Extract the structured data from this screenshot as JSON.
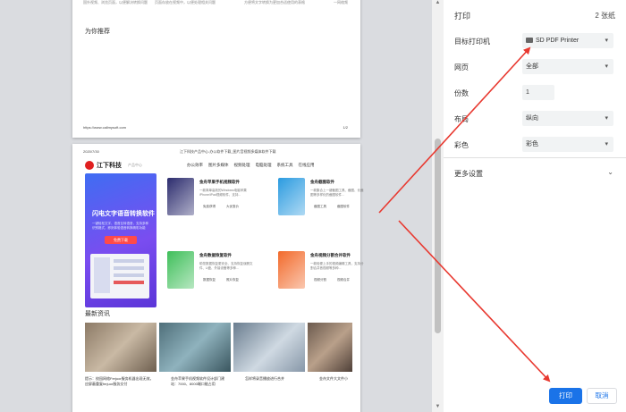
{
  "preview": {
    "page1": {
      "top_texts": [
        "国外视频、浏览页面，以便解决转换问题",
        "页面存放在视频中，以便处理相关问题",
        "方便将文字转换为更加合适使用的表格",
        "一网络频"
      ],
      "recommend": "为你推荐",
      "url": "https://www.callmysoft.com",
      "page_num": "1/2"
    },
    "page2": {
      "date": "2020/7/30",
      "header_title": "江下科技产品中心-办公软件下载_图片音视频多媒体软件下载",
      "logo_name": "江下科技",
      "logo_sub": "产品中心",
      "nav": [
        "办公效率",
        "图片多媒体",
        "视频处理",
        "电脑处理",
        "系统工具",
        "在线应用"
      ],
      "banner": {
        "title": "闪电文字语音转换软件",
        "desc": "一键轻松文字、语音互转语音，支持多种识别格式，即刻体验语音转换精彩功能",
        "button": "免费下载"
      },
      "products": [
        {
          "name": "金舟苹果手机视频软件",
          "desc": "一款简单高效的Windows电脑苹果iPhone/iPad视频软件，支持...",
          "links": [
            "免费获得",
            "大优惠价"
          ],
          "color": "#2c2c6e"
        },
        {
          "name": "金舟截图软件",
          "desc": "一款集合上一键截图工具、截图、长截图等多样化的截图软件...",
          "links": [
            "截图工具",
            "截图软件"
          ],
          "color": "#2b9be0"
        },
        {
          "name": "金舟数据恢复软件",
          "desc": "助您数据恢复更安全、支持恢复误删文件、U盘、外接设备等多种...",
          "links": [
            "数据恢复",
            "照片恢复"
          ],
          "color": "#3fbf5a"
        },
        {
          "name": "金舟视频分割合并软件",
          "desc": "一款轻便上手的视频编辑工具，支持分割合并音视频等多种...",
          "links": [
            "视频分割",
            "视频合并"
          ],
          "color": "#f26a2b"
        }
      ],
      "news_heading": "最新资讯",
      "news": [
        "提示：校园网络Ferjuor服务机器出现无效，应屏蔽重复ferjuor服务交付",
        "金舟苹果手机视频软件设计部门建站：7000、8000端口能占用",
        "怎样将录音播放进行合并",
        "金舟文件大文件小"
      ]
    }
  },
  "settings": {
    "title": "打印",
    "sheet_count": "2 张纸",
    "destination_label": "目标打印机",
    "destination_value": "SD PDF Printer",
    "pages_label": "网页",
    "pages_value": "全部",
    "copies_label": "份数",
    "copies_value": "1",
    "layout_label": "布局",
    "layout_value": "纵向",
    "color_label": "彩色",
    "color_value": "彩色",
    "more_settings": "更多设置",
    "print_button": "打印",
    "cancel_button": "取消",
    "accent_color": "#1a73e8"
  },
  "annotation": {
    "arrow_color": "#e8382f"
  }
}
